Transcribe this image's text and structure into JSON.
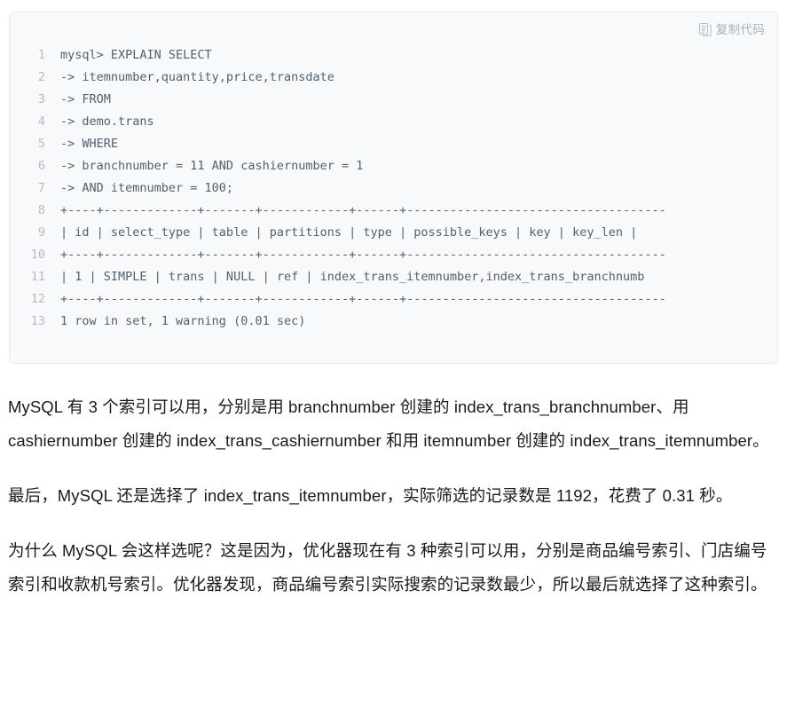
{
  "code_block": {
    "copy_button_label": "复制代码",
    "copy_icon": "copy-document-icon",
    "background_color": "#f8f9fa",
    "line_number_color": "#b5bcc6",
    "text_color": "#52606d",
    "lines": [
      {
        "n": "1",
        "text": "mysql> EXPLAIN SELECT"
      },
      {
        "n": "2",
        "text": "-> itemnumber,quantity,price,transdate"
      },
      {
        "n": "3",
        "text": "-> FROM"
      },
      {
        "n": "4",
        "text": "-> demo.trans"
      },
      {
        "n": "5",
        "text": "-> WHERE"
      },
      {
        "n": "6",
        "text": "-> branchnumber = 11 AND cashiernumber = 1"
      },
      {
        "n": "7",
        "text": "-> AND itemnumber = 100;"
      },
      {
        "n": "8",
        "text": "+----+-------------+-------+------------+------+------------------------------------"
      },
      {
        "n": "9",
        "text": "| id | select_type | table | partitions | type | possible_keys | key | key_len |"
      },
      {
        "n": "10",
        "text": "+----+-------------+-------+------------+------+------------------------------------"
      },
      {
        "n": "11",
        "text": "| 1 | SIMPLE | trans | NULL | ref | index_trans_itemnumber,index_trans_branchnumb"
      },
      {
        "n": "12",
        "text": "+----+-------------+-------+------------+------+------------------------------------"
      },
      {
        "n": "13",
        "text": "1 row in set, 1 warning (0.01 sec)"
      }
    ]
  },
  "article": {
    "paragraphs": [
      "MySQL 有 3 个索引可以用，分别是用 branchnumber 创建的 index_trans_branchnumber、用 cashiernumber 创建的 index_trans_cashiernumber 和用 itemnumber 创建的 index_trans_itemnumber。",
      "最后，MySQL 还是选择了 index_trans_itemnumber，实际筛选的记录数是 1192，花费了 0.31 秒。",
      "为什么 MySQL 会这样选呢？这是因为，优化器现在有 3 种索引可以用，分别是商品编号索引、门店编号索引和收款机号索引。优化器发现，商品编号索引实际搜索的记录数最少，所以最后就选择了这种索引。"
    ]
  }
}
